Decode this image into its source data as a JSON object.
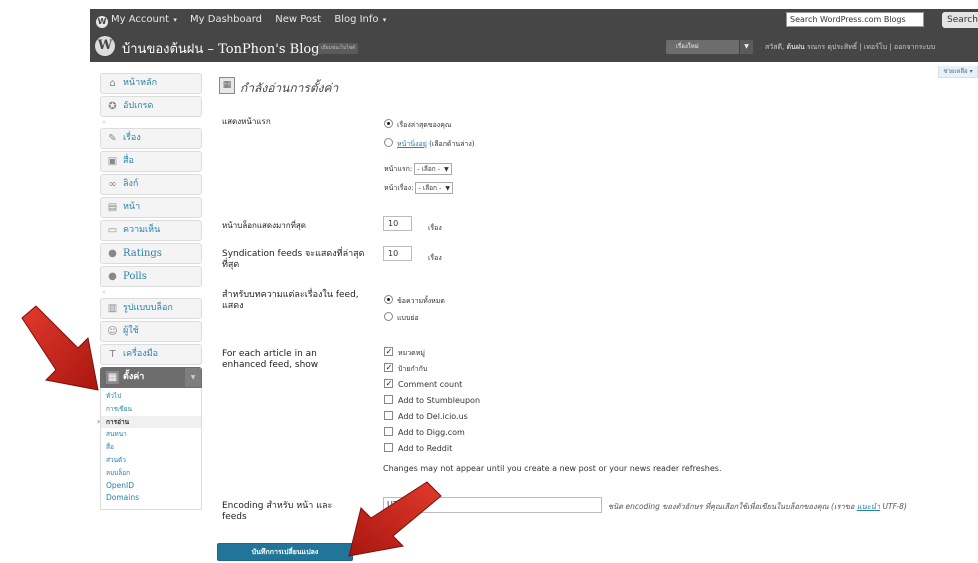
{
  "admin_bar": {
    "my_account": "My Account",
    "my_dashboard": "My Dashboard",
    "new_post": "New Post",
    "blog_info": "Blog Info",
    "search_placeholder": "Search WordPress.com Blogs",
    "search_button": "Search"
  },
  "header": {
    "site_title": "บ้านของต้นฝน – TonPhon's Blog",
    "visit_site": "เยี่ยมชมเว็บไซต์",
    "new_post_button": "เรื่องใหม่",
    "user_greeting": "สวัสดี,",
    "user_name": "ต้นฝน",
    "user_links": "รณกร ดุประสิทธิ์ | เทอร์โบ | ออกจากระบบ"
  },
  "help_tab": "ช่วยเหลือ",
  "menu": {
    "items_top": [
      {
        "label": "หน้าหลัก",
        "icon": "home-icon"
      },
      {
        "label": "อัปเกรด",
        "icon": "upgrade-icon"
      }
    ],
    "items_content": [
      {
        "label": "เรื่อง",
        "icon": "pin-icon"
      },
      {
        "label": "สื่อ",
        "icon": "media-icon"
      },
      {
        "label": "ลิงก์",
        "icon": "link-icon"
      },
      {
        "label": "หน้า",
        "icon": "page-icon"
      },
      {
        "label": "ความเห็น",
        "icon": "comment-icon"
      },
      {
        "label": "Ratings",
        "icon": "ratings-icon"
      },
      {
        "label": "Polls",
        "icon": "polls-icon"
      }
    ],
    "items_admin": [
      {
        "label": "รูปแบบบล็อก",
        "icon": "appearance-icon"
      },
      {
        "label": "ผู้ใช้",
        "icon": "users-icon"
      },
      {
        "label": "เครื่องมือ",
        "icon": "tools-icon"
      }
    ],
    "settings": {
      "label": "ตั้งค่า",
      "icon": "settings-icon"
    },
    "settings_sub": [
      "ทั่วไป",
      "การเขียน",
      "การอ่าน",
      "สนทนา",
      "สื่อ",
      "ส่วนตัว",
      "ลบบล็อก",
      "OpenID",
      "Domains"
    ]
  },
  "page_title": "กำลังอ่านการตั้งค่า",
  "form": {
    "front_page_label": "แสดงหน้าแรก",
    "front_latest": "เรื่องล่าสุดของคุณ",
    "front_static_link": "หน้านิ่งอยู่",
    "front_static_rest": "(เลือกด้านล่าง)",
    "front_page_select_label": "หน้าแรก:",
    "posts_page_select_label": "หน้าเรื่อง:",
    "select_default": "- เลือก -",
    "posts_per_page_label": "หน้าบล็อกแสดงมากที่สุด",
    "posts_per_page_value": "10",
    "posts_unit": "เรื่อง",
    "feeds_label": "Syndication feeds จะแสดงที่ล่าสุดที่สุด",
    "feeds_value": "10",
    "feeds_unit": "เรื่อง",
    "feed_show_label": "สำหรับบทความแต่ละเรื่องใน feed, แสดง",
    "feed_full": "ข้อความทั้งหมด",
    "feed_summary": "แบบย่อ",
    "enhanced_label": "For each article in an enhanced feed, show",
    "enhanced_options": [
      {
        "label": "หมวดหมู่",
        "checked": true
      },
      {
        "label": "ป้ายกำกับ",
        "checked": true
      },
      {
        "label": "Comment count",
        "checked": true
      },
      {
        "label": "Add to Stumbleupon",
        "checked": false
      },
      {
        "label": "Add to Del.icio.us",
        "checked": false
      },
      {
        "label": "Add to Digg.com",
        "checked": false
      },
      {
        "label": "Add to Reddit",
        "checked": false
      }
    ],
    "notice": "Changes may not appear until you create a new post or your news reader refreshes.",
    "encoding_label": "Encoding สำหรับ หน้า และ feeds",
    "encoding_value": "UTF-8",
    "encoding_desc_pre": "ชนิด encoding ของตัวอักษร ที่คุณเลือกใช้เพื่อเขียนในบล็อกของคุณ (เราขอ",
    "encoding_desc_link": "แนะนำ",
    "encoding_desc_post": "UTF-8)",
    "save_button": "บันทึกการเปลี่ยนแปลง"
  },
  "colors": {
    "admin_bar": "#464646",
    "link": "#2583ad",
    "button": "#21759b",
    "arrow": "#d0261d"
  }
}
